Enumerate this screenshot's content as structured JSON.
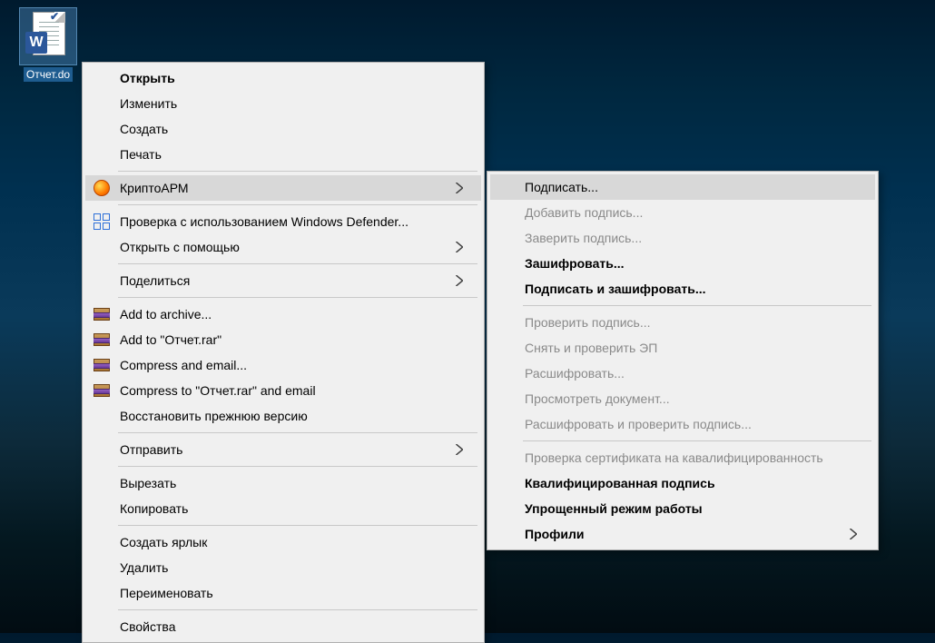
{
  "desktop_icon": {
    "label": "Отчет.do",
    "badge": "W"
  },
  "main_menu": {
    "open": "Открыть",
    "edit": "Изменить",
    "create": "Создать",
    "print": "Печать",
    "cryptoarm": "КриптоАРМ",
    "defender": "Проверка с использованием Windows Defender...",
    "open_with": "Открыть с помощью",
    "share": "Поделиться",
    "add_archive": "Add to archive...",
    "add_to_rar": "Add to \"Отчет.rar\"",
    "compress_email": "Compress and email...",
    "compress_to_email": "Compress to \"Отчет.rar\" and email",
    "restore_prev": "Восстановить прежнюю версию",
    "send": "Отправить",
    "cut": "Вырезать",
    "copy": "Копировать",
    "shortcut": "Создать ярлык",
    "delete": "Удалить",
    "rename": "Переименовать",
    "properties": "Свойства"
  },
  "sub_menu": {
    "sign": "Подписать...",
    "add_sig": "Добавить подпись...",
    "certify_sig": "Заверить подпись...",
    "encrypt": "Зашифровать...",
    "sign_encrypt": "Подписать и зашифровать...",
    "verify_sig": "Проверить подпись...",
    "remove_verify": "Снять и проверить ЭП",
    "decrypt": "Расшифровать...",
    "view_doc": "Просмотреть документ...",
    "decrypt_verify": "Расшифровать и проверить подпись...",
    "check_cert": "Проверка сертификата на кавалифицированность",
    "qualified_sig": "Квалифицированная подпись",
    "simple_mode": "Упрощенный режим работы",
    "profiles": "Профили"
  }
}
